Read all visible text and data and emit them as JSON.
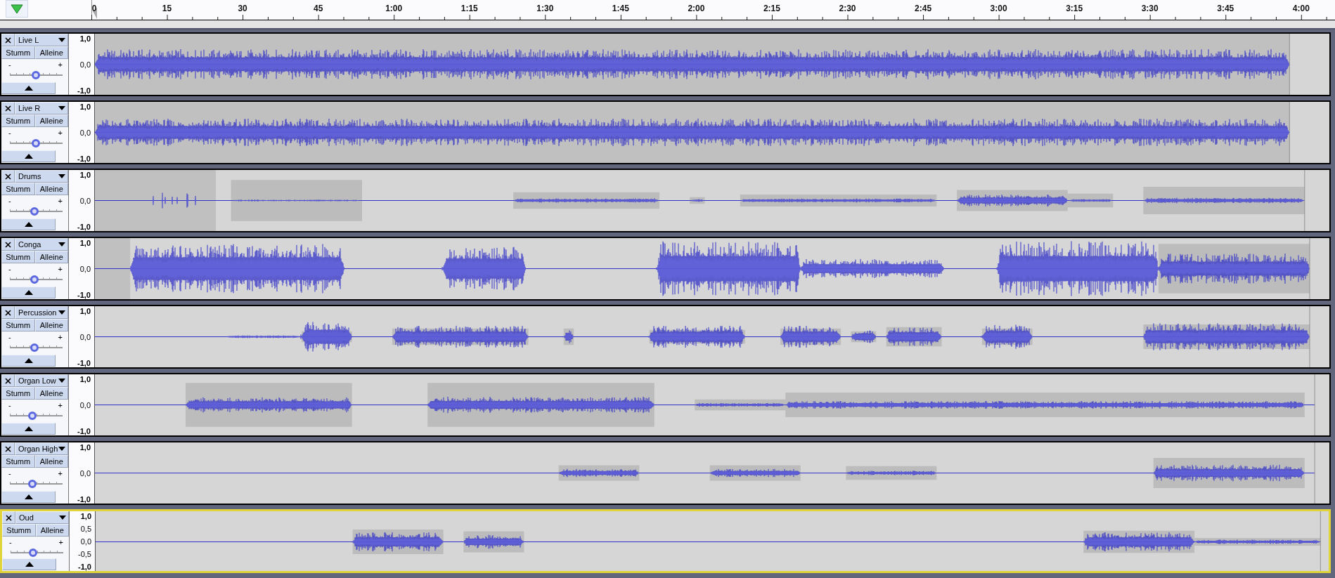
{
  "ruler": {
    "labels": [
      "0",
      "15",
      "30",
      "45",
      "1:00",
      "1:15",
      "1:30",
      "1:45",
      "2:00",
      "2:15",
      "2:30",
      "2:45",
      "3:00",
      "3:15",
      "3:30",
      "3:45",
      "4:00"
    ]
  },
  "tracks": [
    {
      "name": "Live L",
      "selected": false,
      "mute_label": "Stumm",
      "solo_label": "Alleine",
      "muted": false,
      "solo": false,
      "gain_min": "-",
      "gain_max": "+",
      "gain": {
        "level": 0.49
      },
      "scale_labels": [
        "1,0",
        "0,0",
        "-1,0"
      ]
    },
    {
      "name": "Live R",
      "selected": false,
      "mute_label": "Stumm",
      "solo_label": "Alleine",
      "muted": false,
      "solo": false,
      "gain_min": "-",
      "gain_max": "+",
      "gain": {
        "level": 0.49
      },
      "scale_labels": [
        "1,0",
        "0,0",
        "-1,0"
      ]
    },
    {
      "name": "Drums",
      "selected": false,
      "mute_label": "Stumm",
      "solo_label": "Alleine",
      "muted": false,
      "solo": false,
      "gain_min": "-",
      "gain_max": "+",
      "gain": {
        "level": 0.47
      },
      "scale_labels": [
        "1,0",
        "0,0",
        "-1,0"
      ]
    },
    {
      "name": "Conga",
      "selected": false,
      "mute_label": "Stumm",
      "solo_label": "Alleine",
      "muted": false,
      "solo": false,
      "gain_min": "-",
      "gain_max": "+",
      "gain": {
        "level": 0.47
      },
      "scale_labels": [
        "1,0",
        "0,0",
        "-1,0"
      ]
    },
    {
      "name": "Percussion",
      "selected": false,
      "mute_label": "Stumm",
      "solo_label": "Alleine",
      "muted": false,
      "solo": false,
      "gain_min": "-",
      "gain_max": "+",
      "gain": {
        "level": 0.47
      },
      "scale_labels": [
        "1,0",
        "0,0",
        "-1,0"
      ]
    },
    {
      "name": "Organ Low",
      "selected": false,
      "mute_label": "Stumm",
      "solo_label": "Alleine",
      "muted": false,
      "solo": false,
      "gain_min": "-",
      "gain_max": "+",
      "gain": {
        "level": 0.42
      },
      "scale_labels": [
        "1,0",
        "0,0",
        "-1,0"
      ]
    },
    {
      "name": "Organ High",
      "selected": false,
      "mute_label": "Stumm",
      "solo_label": "Alleine",
      "muted": false,
      "solo": false,
      "gain_min": "-",
      "gain_max": "+",
      "gain": {
        "level": 0.42
      },
      "scale_labels": [
        "1,0",
        "0,0",
        "-1,0"
      ]
    },
    {
      "name": "Oud",
      "selected": true,
      "mute_label": "Stumm",
      "solo_label": "Alleine",
      "muted": false,
      "solo": false,
      "gain_min": "-",
      "gain_max": "+",
      "gain": {
        "level": 0.42
      },
      "scale_labels": [
        "1,0",
        "0,5",
        "0,0",
        "-0,5",
        "-1,0"
      ]
    }
  ]
}
